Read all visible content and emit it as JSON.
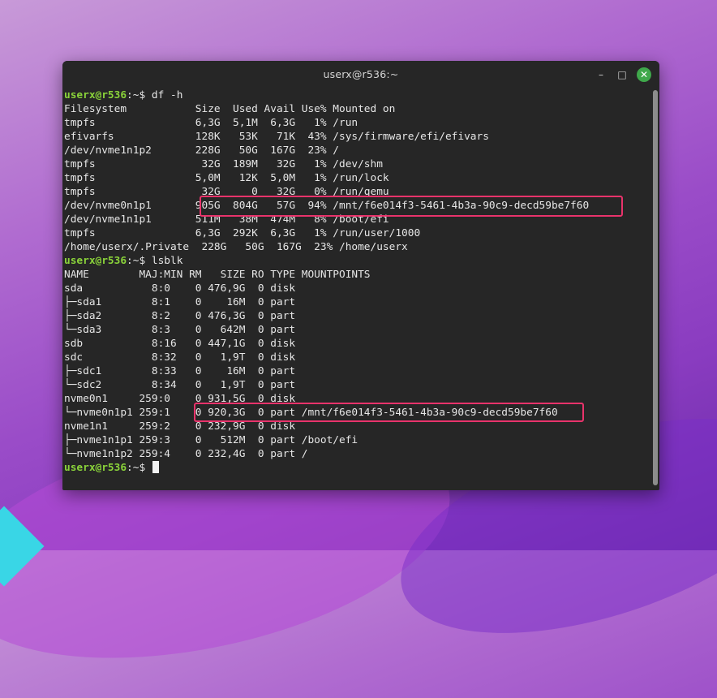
{
  "window": {
    "title": "userx@r536:~",
    "minimize_glyph": "–",
    "maximize_glyph": "□",
    "close_glyph": "✕"
  },
  "terminal": {
    "prompt_user": "userx@r536",
    "prompt_sep": ":~$",
    "commands": {
      "df": "df -h",
      "lsblk": "lsblk"
    },
    "df_lines": [
      "Filesystem           Size  Used Avail Use% Mounted on",
      "tmpfs                6,3G  5,1M  6,3G   1% /run",
      "efivarfs             128K   53K   71K  43% /sys/firmware/efi/efivars",
      "/dev/nvme1n1p2       228G   50G  167G  23% /",
      "tmpfs                 32G  189M   32G   1% /dev/shm",
      "tmpfs                5,0M   12K  5,0M   1% /run/lock",
      "tmpfs                 32G     0   32G   0% /run/qemu",
      "/dev/nvme0n1p1       905G  804G   57G  94% /mnt/f6e014f3-5461-4b3a-90c9-decd59be7f60",
      "/dev/nvme1n1p1       511M   38M  474M   8% /boot/efi",
      "tmpfs                6,3G  292K  6,3G   1% /run/user/1000",
      "/home/userx/.Private  228G   50G  167G  23% /home/userx"
    ],
    "lsblk_lines": [
      "NAME        MAJ:MIN RM   SIZE RO TYPE MOUNTPOINTS",
      "sda           8:0    0 476,9G  0 disk",
      "├─sda1        8:1    0    16M  0 part",
      "├─sda2        8:2    0 476,3G  0 part",
      "└─sda3        8:3    0   642M  0 part",
      "sdb           8:16   0 447,1G  0 disk",
      "sdc           8:32   0   1,9T  0 disk",
      "├─sdc1        8:33   0    16M  0 part",
      "└─sdc2        8:34   0   1,9T  0 part",
      "nvme0n1     259:0    0 931,5G  0 disk",
      "└─nvme0n1p1 259:1    0 920,3G  0 part /mnt/f6e014f3-5461-4b3a-90c9-decd59be7f60",
      "nvme1n1     259:2    0 232,9G  0 disk",
      "├─nvme1n1p1 259:3    0   512M  0 part /boot/efi",
      "└─nvme1n1p2 259:4    0 232,4G  0 part /"
    ]
  },
  "colors": {
    "prompt": "#8ad33a",
    "highlight": "#e8336b",
    "terminal_bg": "#262626"
  }
}
